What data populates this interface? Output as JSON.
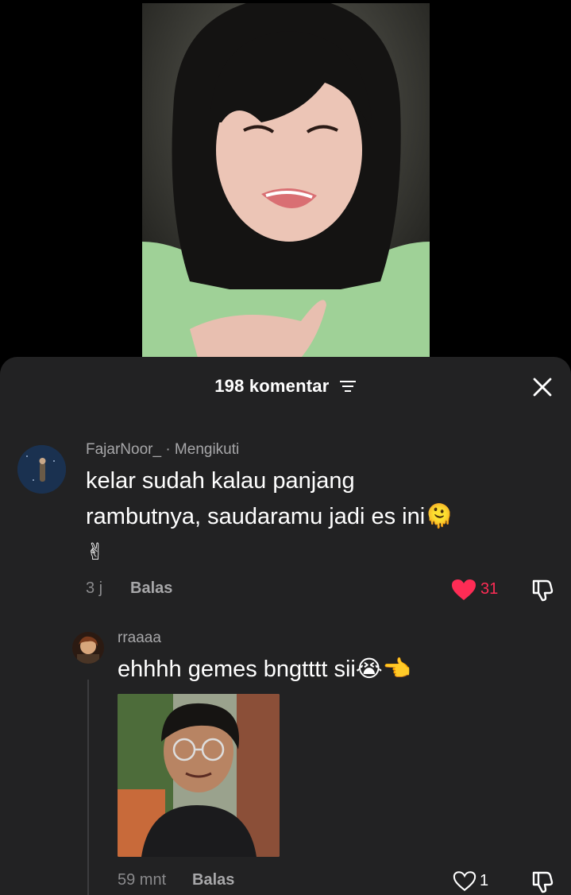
{
  "video": {
    "description_icon": "video-thumbnail"
  },
  "header": {
    "title": "198 komentar",
    "filter_icon": "filter-icon",
    "close_icon": "close-icon"
  },
  "comments": [
    {
      "username": "FajarNoor_",
      "badge": "· Mengikuti",
      "text_line1": "kelar sudah kalau panjang",
      "text_line2": "rambutnya, saudaramu jadi es ini",
      "emoji_melting": "🫠",
      "emoji_victory": "✌",
      "time": "3 j",
      "reply_label": "Balas",
      "likes": "31",
      "liked": true
    }
  ],
  "replies": [
    {
      "username": "rraaaa",
      "text": "ehhhh gemes bngtttt sii",
      "emoji_crying": "😭",
      "emoji_pointing": "👈",
      "time": "59 mnt",
      "reply_label": "Balas",
      "likes": "1",
      "liked": false
    }
  ],
  "colors": {
    "sheet_bg": "#222223",
    "like_red": "#fe2c55",
    "secondary_text": "#a7a7a9"
  }
}
